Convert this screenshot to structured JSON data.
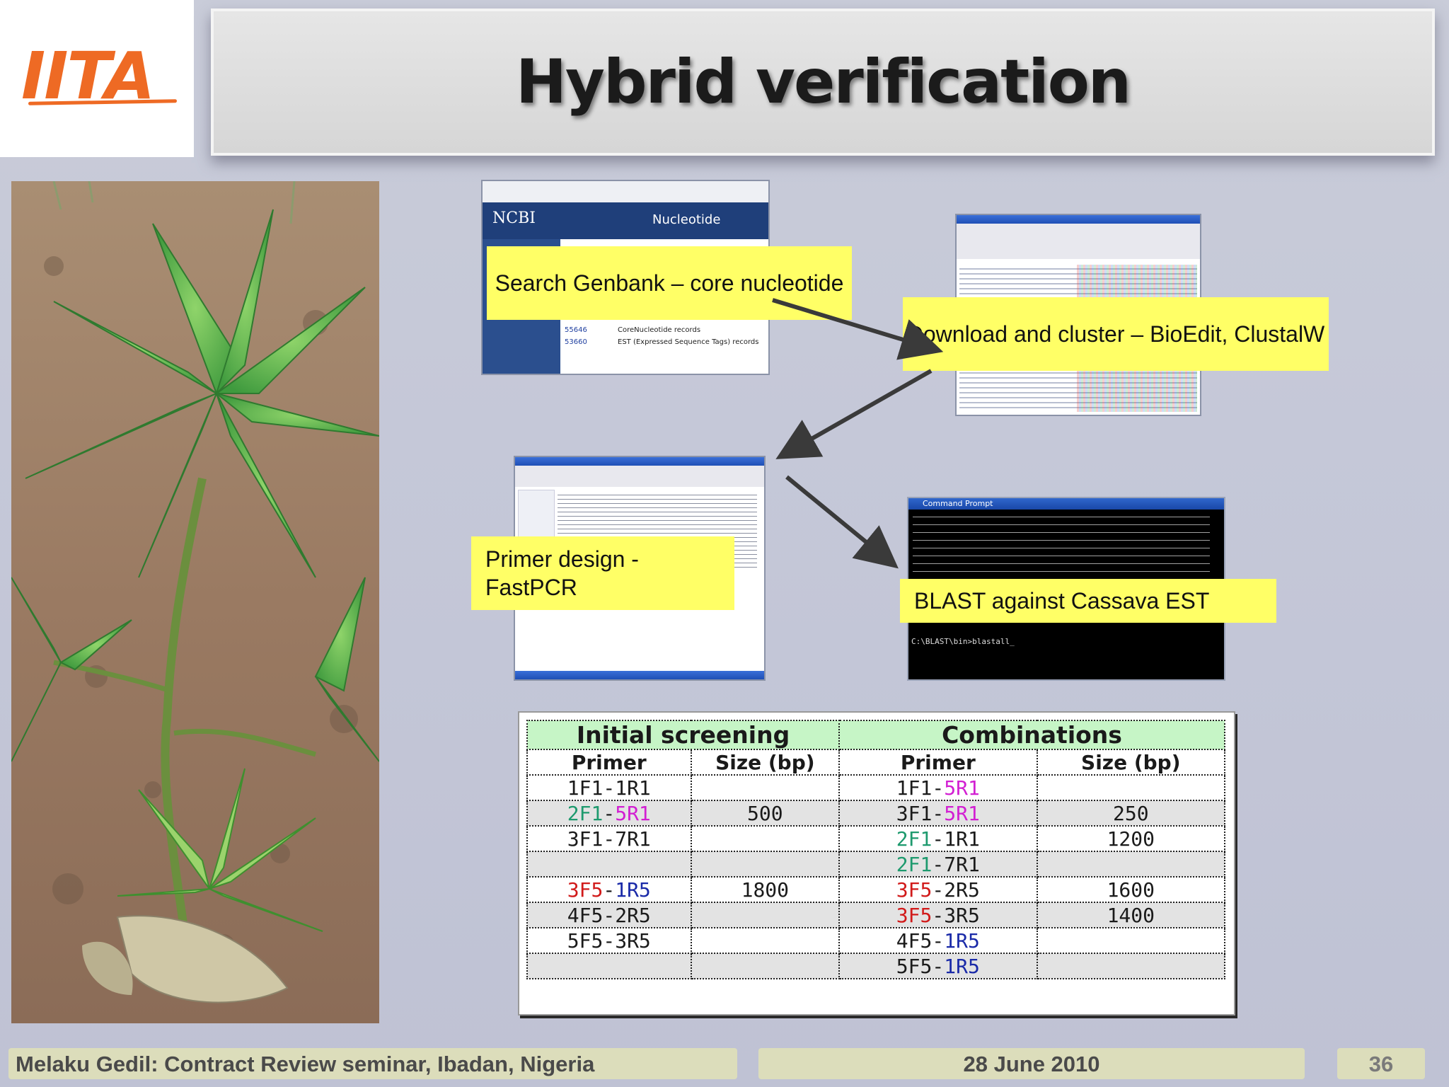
{
  "logo": {
    "text": "IITA"
  },
  "title": "Hybrid verification",
  "callouts": {
    "search": "Search Genbank – core nucleotide",
    "download": "Download and cluster – BioEdit, ClustalW",
    "primer": "Primer design - FastPCR",
    "blast": "BLAST against Cassava EST"
  },
  "ncbi_shot": {
    "brand": "NCBI",
    "db": "Nucleotide",
    "rows": [
      {
        "count": "55646",
        "label": "CoreNucleotide records"
      },
      {
        "count": "53660",
        "label": "EST (Expressed Sequence Tags) records"
      }
    ]
  },
  "cmd_shot": {
    "title": "Command Prompt",
    "prompt": "C:\\BLAST\\bin>blastall_"
  },
  "table": {
    "groups": [
      "Initial screening",
      "Combinations"
    ],
    "columns": [
      "Primer",
      "Size (bp)",
      "Primer",
      "Size (bp)"
    ],
    "rows": [
      [
        [
          {
            "t": "1F1-1R1",
            "c": "#1a1a1a"
          }
        ],
        "",
        [
          {
            "t": "1F1-",
            "c": "#1a1a1a"
          },
          {
            "t": "5R1",
            "c": "#d21fd2"
          }
        ],
        ""
      ],
      [
        [
          {
            "t": "2F1",
            "c": "#1e9a6e"
          },
          {
            "t": "-",
            "c": "#1a1a1a"
          },
          {
            "t": "5R1",
            "c": "#d21fd2"
          }
        ],
        "500",
        [
          {
            "t": "3F1-",
            "c": "#1a1a1a"
          },
          {
            "t": "5R1",
            "c": "#d21fd2"
          }
        ],
        "250"
      ],
      [
        [
          {
            "t": "3F1-7R1",
            "c": "#1a1a1a"
          }
        ],
        "",
        [
          {
            "t": "2F1",
            "c": "#1e9a6e"
          },
          {
            "t": "-1R1",
            "c": "#1a1a1a"
          }
        ],
        "1200"
      ],
      [
        [],
        "",
        [
          {
            "t": "2F1",
            "c": "#1e9a6e"
          },
          {
            "t": "-7R1",
            "c": "#1a1a1a"
          }
        ],
        ""
      ],
      [
        [
          {
            "t": "3F5",
            "c": "#d11a1a"
          },
          {
            "t": "-",
            "c": "#1a1a1a"
          },
          {
            "t": "1R5",
            "c": "#1a2aa8"
          }
        ],
        "1800",
        [
          {
            "t": "3F5",
            "c": "#d11a1a"
          },
          {
            "t": "-2R5",
            "c": "#1a1a1a"
          }
        ],
        "1600"
      ],
      [
        [
          {
            "t": "4F5-2R5",
            "c": "#1a1a1a"
          }
        ],
        "",
        [
          {
            "t": "3F5",
            "c": "#d11a1a"
          },
          {
            "t": "-3R5",
            "c": "#1a1a1a"
          }
        ],
        "1400"
      ],
      [
        [
          {
            "t": "5F5-3R5",
            "c": "#1a1a1a"
          }
        ],
        "",
        [
          {
            "t": "4F5-",
            "c": "#1a1a1a"
          },
          {
            "t": "1R5",
            "c": "#1a2aa8"
          }
        ],
        ""
      ],
      [
        [],
        "",
        [
          {
            "t": "5F5-",
            "c": "#1a1a1a"
          },
          {
            "t": "1R5",
            "c": "#1a2aa8"
          }
        ],
        ""
      ]
    ]
  },
  "footer": {
    "left": "Melaku Gedil: Contract Review seminar,  Ibadan, Nigeria",
    "date": "28 June 2010",
    "page": "36"
  },
  "colors": {
    "callout": "#ffff66",
    "logo": "#ee6a24",
    "table_header": "#c6f5c6"
  }
}
